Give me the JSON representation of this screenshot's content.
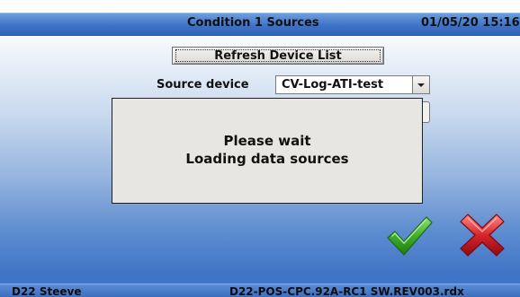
{
  "header": {
    "title": "Condition 1 Sources",
    "datetime": "01/05/20 15:16"
  },
  "refresh_button": {
    "label": "Refresh Device List"
  },
  "source_device": {
    "label": "Source device",
    "selected": "CV-Log-ATI-test"
  },
  "dialog": {
    "line1": "Please wait",
    "line2": "Loading data sources"
  },
  "actions": {
    "ok_icon": "green-checkmark-icon",
    "cancel_icon": "red-x-icon"
  },
  "status": {
    "left": "D22 Steeve",
    "right": "D22-POS-CPC.92A-RC1 SW.REV003.rdx"
  },
  "colors": {
    "title_bar": "#3e74c8",
    "ok": "#3fae2a",
    "cancel": "#d8232a",
    "dialog_bg": "#e8e6e2"
  }
}
